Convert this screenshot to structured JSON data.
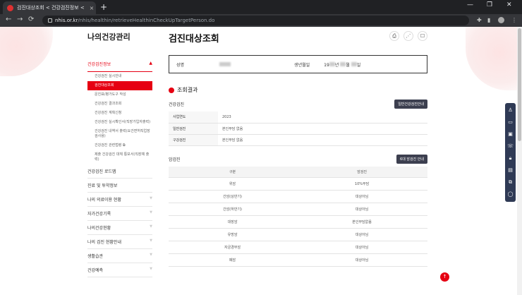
{
  "browser": {
    "tab_title": "검진대상조회 < 건강검진정보 <",
    "tab_close": "×",
    "new_tab": "+",
    "url_host": "nhis.or.kr",
    "url_path": "/nhis/healthin/retrieveHealthinCheckUpTargetPerson.do",
    "back": "←",
    "forward": "→",
    "reload": "⟳",
    "minimize": "—",
    "maximize": "❐",
    "close": "✕"
  },
  "sidebar": {
    "title": "나의건강관리",
    "section": "건강검진정보",
    "section_arrow": "▲",
    "subitems": [
      "건강검진 실시안내",
      "검진대상조회",
      "문진표/평가도구 작성",
      "건강검진 결과조회",
      "건강검진 계획신청",
      "건강검진 실시확인서(직장가입자출력)",
      "건강검진 내역서 출력(요건면허직업장 검사용)",
      "건강검진 관련법령 ⧉",
      "제출 건강검진 대체 통보서(직장예 출력)"
    ],
    "items": [
      {
        "label": "건강검진 로드맵",
        "arrow": ""
      },
      {
        "label": "진료 및 투약정보",
        "arrow": ""
      },
      {
        "label": "나의 의료이용 현황",
        "arrow": "▼"
      },
      {
        "label": "자가건강기록",
        "arrow": "▼"
      },
      {
        "label": "나의건강현황",
        "arrow": "▼"
      },
      {
        "label": "나의 검진 현황안내",
        "arrow": "▼"
      },
      {
        "label": "생활습관",
        "arrow": "▼"
      },
      {
        "label": "건강예측",
        "arrow": "▼"
      }
    ]
  },
  "main": {
    "title": "검진대상조회",
    "icons": {
      "print": "⎙",
      "share": "⋰",
      "bookmark": "☐"
    },
    "info": {
      "name_label": "성명",
      "birth_label": "생년월일",
      "birth_prefix": "19",
      "year_suffix": "년",
      "month_suffix": "월",
      "day_suffix": "일"
    },
    "result_title": "조회결과",
    "general": {
      "label": "건강검진",
      "button": "일반건강검진안내",
      "rows": [
        {
          "k": "사업연도",
          "v": "2023"
        },
        {
          "k": "일반검진",
          "v": "본인부담 없음"
        },
        {
          "k": "구강검진",
          "v": "본인부담 없음"
        }
      ]
    },
    "cancer": {
      "label": "암검진",
      "button": "6대 암검진 안내",
      "headers": [
        "구분",
        "암검진"
      ],
      "rows": [
        {
          "k": "위암",
          "v": "10%부담"
        },
        {
          "k": "간암(상반기)",
          "v": "대상아님"
        },
        {
          "k": "간암(하반기)",
          "v": "대상아님"
        },
        {
          "k": "대장암",
          "v": "본인부담없음"
        },
        {
          "k": "유방암",
          "v": "대상아님"
        },
        {
          "k": "자궁경부암",
          "v": "대상아님"
        },
        {
          "k": "폐암",
          "v": "대상아님"
        }
      ]
    }
  },
  "quick_menu": [
    "♙",
    "▭",
    "▣",
    "☏",
    "🔒︎",
    "▤",
    "⧉",
    "◯"
  ],
  "top_button": "↑"
}
